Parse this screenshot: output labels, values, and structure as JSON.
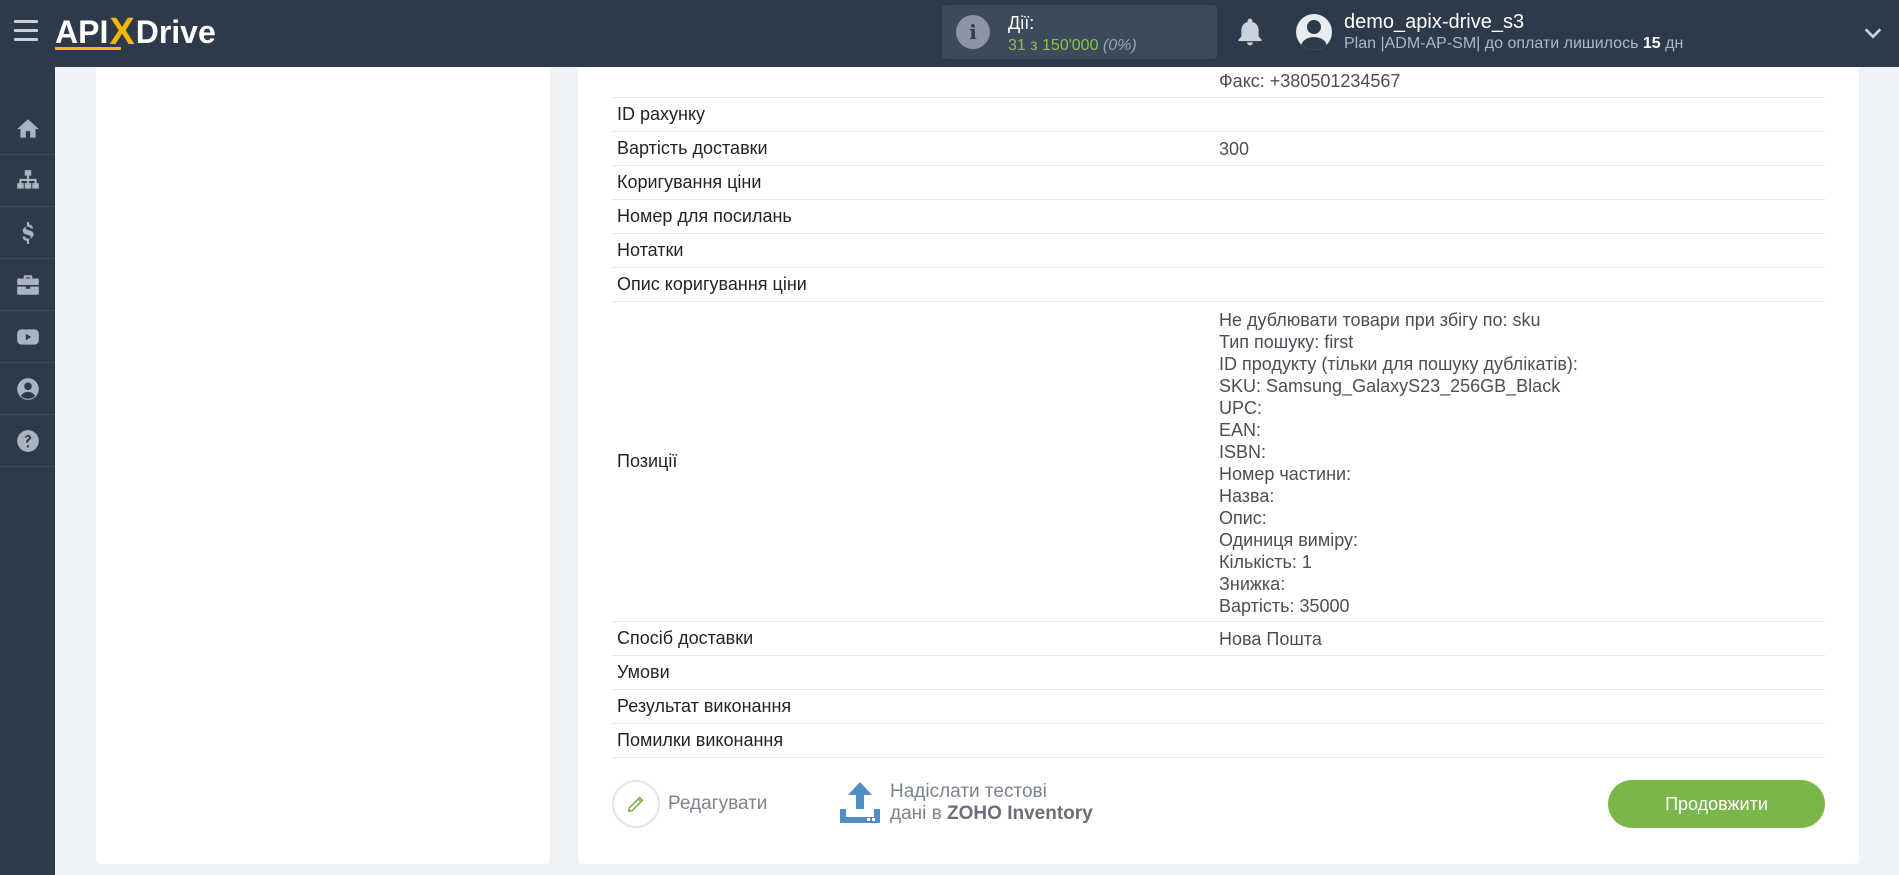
{
  "header": {
    "logo": {
      "part1": "API",
      "part2": "X",
      "part3": "Drive"
    },
    "actions": {
      "label": "Дії:",
      "count": "31 з 150'000",
      "percent": "(0%)"
    },
    "user": {
      "name": "demo_apix-drive_s3",
      "plan_prefix": "Plan |ADM-AP-SM| до оплати лишилось ",
      "days": "15",
      "days_suffix": " дн"
    }
  },
  "sidebar": {
    "items": [
      {
        "icon": "home-icon"
      },
      {
        "icon": "sitemap-icon"
      },
      {
        "icon": "dollar-icon"
      },
      {
        "icon": "briefcase-icon"
      },
      {
        "icon": "youtube-icon"
      },
      {
        "icon": "user-circle-icon"
      },
      {
        "icon": "question-icon"
      }
    ]
  },
  "table": {
    "top_value": "Факс: +380501234567",
    "rows": [
      {
        "key": "ID рахунку",
        "value": ""
      },
      {
        "key": "Вартість доставки",
        "value": "300"
      },
      {
        "key": "Коригування ціни",
        "value": ""
      },
      {
        "key": "Номер для посилань",
        "value": ""
      },
      {
        "key": "Нотатки",
        "value": ""
      },
      {
        "key": "Опис коригування ціни",
        "value": ""
      }
    ],
    "positions": {
      "key": "Позиції",
      "lines": [
        "Не дублювати товари при збігу по: sku",
        "Тип пошуку: first",
        "ID продукту (тільки для пошуку дублікатів):",
        "SKU: Samsung_GalaxyS23_256GB_Black",
        "UPC:",
        "EAN:",
        "ISBN:",
        "Номер частини:",
        "Назва:",
        "Опис:",
        "Одиниця виміру:",
        "Кількість: 1",
        "Знижка:",
        "Вартість: 35000"
      ]
    },
    "rows_after": [
      {
        "key": "Спосіб доставки",
        "value": "Нова Пошта"
      },
      {
        "key": "Умови",
        "value": ""
      },
      {
        "key": "Результат виконання",
        "value": ""
      },
      {
        "key": "Помилки виконання",
        "value": ""
      }
    ]
  },
  "bottom": {
    "edit_label": "Редагувати",
    "send_line1": "Надіслати тестові",
    "send_line2_prefix": "дані в ",
    "send_line2_service": "ZOHO Inventory",
    "continue_label": "Продовжити"
  },
  "colors": {
    "header_bg": "#2d3a4a",
    "accent_yellow": "#f5b800",
    "accent_green": "#7ab648",
    "count_green": "#8bc34a",
    "upload_blue": "#4f8fc6"
  }
}
